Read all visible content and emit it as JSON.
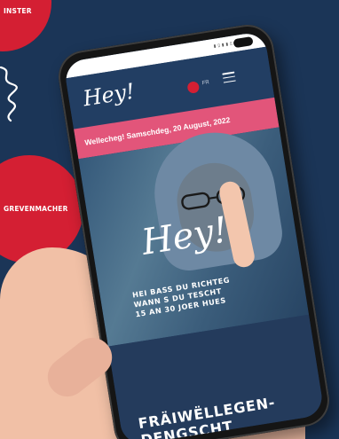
{
  "background": {
    "color": "#1b3557"
  },
  "badges": {
    "top_left": "INSTER",
    "left": "GREVENMACHER",
    "color": "#d41f33"
  },
  "phone": {
    "screen": {
      "logo": "Hey!",
      "lang_label": "FR",
      "banner_text": "Wellecheg! Samschdeg, 20 August, 2022",
      "hero_logo": "Hey!",
      "headline_lines": [
        "HEI BASS DU RICHTEG",
        "WANN S DU TESCHT",
        "15 AN 30 JOER HUES"
      ],
      "bottom_title_lines": [
        "FRÄIWËLLEGEN-",
        "DENGSCHT"
      ]
    }
  }
}
